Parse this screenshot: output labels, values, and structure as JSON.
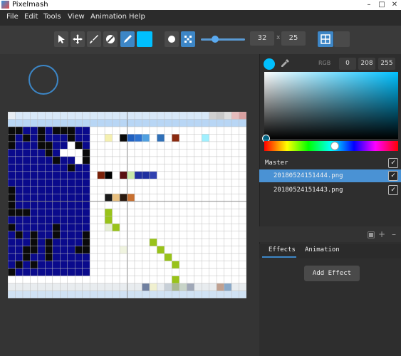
{
  "window": {
    "title": "Pixelmash"
  },
  "menu": [
    "File",
    "Edit",
    "Tools",
    "View",
    "Animation",
    "Help"
  ],
  "toolbar": {
    "tools": [
      "pointer-tool",
      "move-tool",
      "brush-tool",
      "eraser-tool",
      "pencil-tool"
    ],
    "active_tool": "pencil-tool",
    "current_color": "#00c0ff",
    "brush_size_value": 0.3,
    "width": "32",
    "height": "25",
    "size_separator": "x"
  },
  "color_picker": {
    "rgb_label": "RGB",
    "r": "0",
    "g": "208",
    "b": "255"
  },
  "layers": {
    "master_label": "Master",
    "items": [
      {
        "name": "20180524151444.png",
        "selected": true,
        "visible": true
      },
      {
        "name": "20180524151443.png",
        "selected": false,
        "visible": true
      }
    ]
  },
  "panel_tabs": [
    "Effects",
    "Animation"
  ],
  "effects": {
    "add_button": "Add Effect"
  },
  "colors": {
    "navy": "#0a0a8c",
    "black": "#0a0a0a",
    "white": "#ffffff",
    "accent": "#3d86c6",
    "green": "#99c31a"
  }
}
